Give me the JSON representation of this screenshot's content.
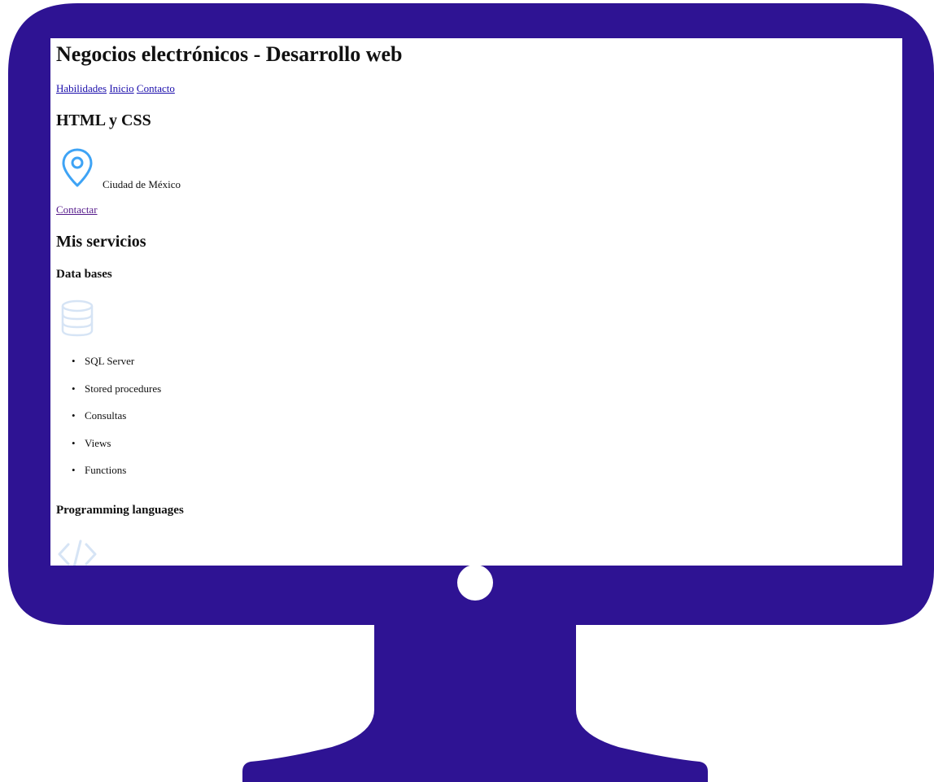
{
  "site": {
    "title": "Negocios electrónicos - Desarrollo web"
  },
  "nav": {
    "links": [
      "Habilidades",
      "Inicio",
      "Contacto"
    ]
  },
  "section_html": {
    "heading": "HTML y CSS",
    "location_icon": "map-pin-icon",
    "location_text": "Ciudad de México",
    "contact_link": "Contactar"
  },
  "services": {
    "heading": "Mis servicios",
    "data_bases": {
      "heading": "Data bases",
      "icon": "database-icon",
      "items": [
        "SQL Server",
        "Stored procedures",
        "Consultas",
        "Views",
        "Functions"
      ]
    },
    "programming": {
      "heading": "Programming languages",
      "icon": "code-icon"
    }
  },
  "colors": {
    "monitor_frame": "#2e1393",
    "pin_icon": "#3ea3f5",
    "faded_icon": "#d6e4f5",
    "link": "#1a0dab",
    "visited_link": "#551a8b"
  }
}
